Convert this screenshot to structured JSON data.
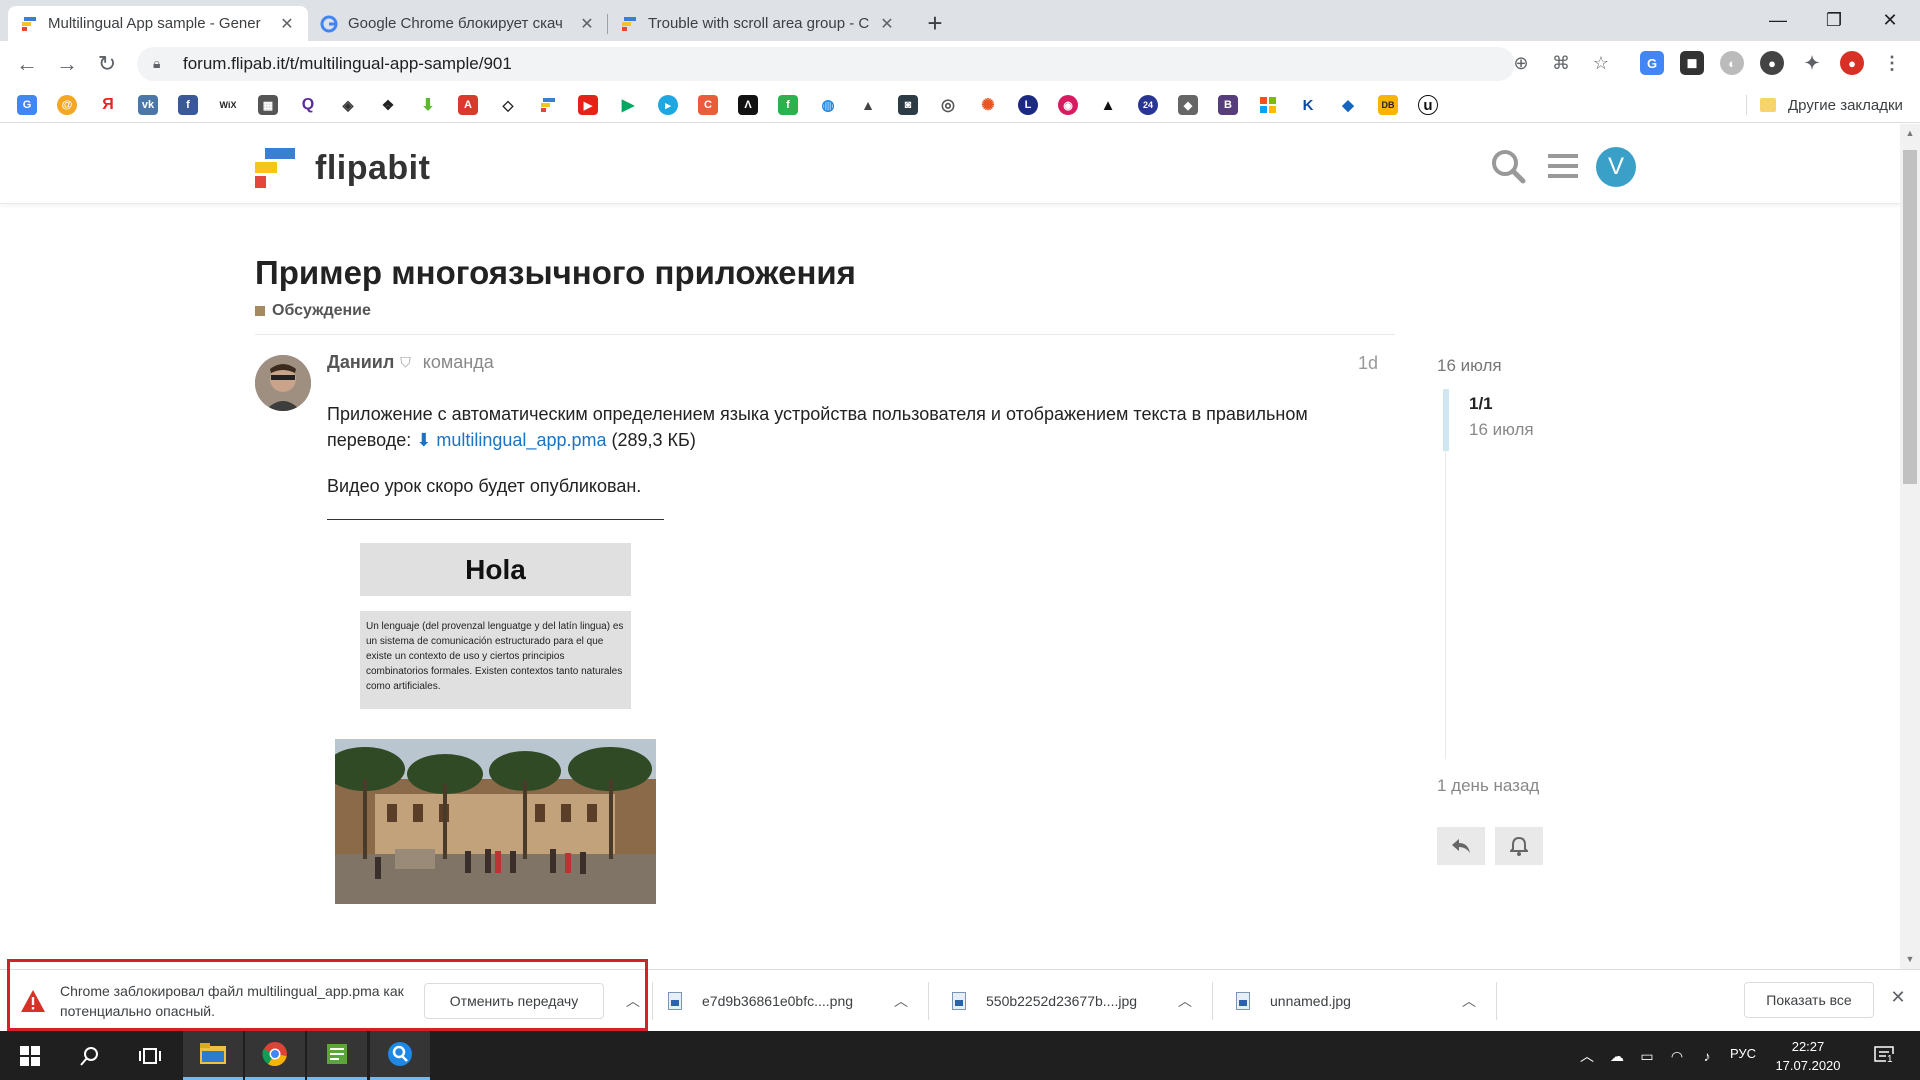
{
  "browser": {
    "tabs": [
      {
        "title": "Multilingual App sample - Gener",
        "active": true
      },
      {
        "title": "Google Chrome блокирует скач",
        "active": false
      },
      {
        "title": "Trouble with scroll area group - C",
        "active": false
      }
    ],
    "url": "forum.flipab.it/t/multilingual-app-sample/901",
    "bookmark_icons": [
      "google-translate",
      "at-sign",
      "yandex",
      "vk",
      "facebook",
      "wix",
      "calculator",
      "qualtrics",
      "cube",
      "package",
      "download",
      "adobe",
      "codepen",
      "flipabit",
      "youtube",
      "google-play",
      "play-circle",
      "pdf",
      "adobe-sign",
      "feedly",
      "drop",
      "graduation",
      "camera",
      "globe",
      "ubuntu",
      "luna",
      "target",
      "academic",
      "circle-24",
      "photo",
      "bootstrap",
      "microsoft",
      "key",
      "arrow",
      "db",
      "unreal"
    ],
    "other_bookmarks": "Другие закладки"
  },
  "site": {
    "logo_text": "flipabit",
    "avatar_letter": "V"
  },
  "topic": {
    "title": "Пример многоязычного приложения",
    "category": "Обсуждение"
  },
  "post": {
    "author": "Даниил",
    "group": "команда",
    "age": "1d",
    "para1_text": "Приложение с автоматическим определением языка устройства пользователя и отображением текста в правильном переводе: ",
    "attachment_name": "multilingual_app.pma",
    "attachment_size": "(289,3 КБ)",
    "para2": "Видео урок скоро будет опубликован.",
    "image_heading": "Hola",
    "image_paragraph": "Un lenguaje (del provenzal lenguatge y del latín lingua) es un sistema de comunicación estructurado para el que existe un contexto de uso y ciertos principios combinatorios formales. Existen contextos tanto naturales como artificiales."
  },
  "timeline": {
    "top_date": "16 июля",
    "count": "1/1",
    "current_date": "16 июля",
    "bottom": "1 день назад"
  },
  "downloads": {
    "blocked_message": "Chrome заблокировал файл multilingual_app.pma как потенциально опасный.",
    "cancel_label": "Отменить передачу",
    "items": [
      "e7d9b36861e0bfc....png",
      "550b2252d23677b....jpg",
      "unnamed.jpg"
    ],
    "show_all": "Показать все"
  },
  "taskbar": {
    "language": "РУС",
    "time": "22:27",
    "date": "17.07.2020",
    "notification_count": "1"
  },
  "colors": {
    "accent_blue": "#1a73c4",
    "avatar_blue": "#3aa0c7",
    "warning_red": "#d4202a",
    "category_tan": "#a58a5f"
  }
}
